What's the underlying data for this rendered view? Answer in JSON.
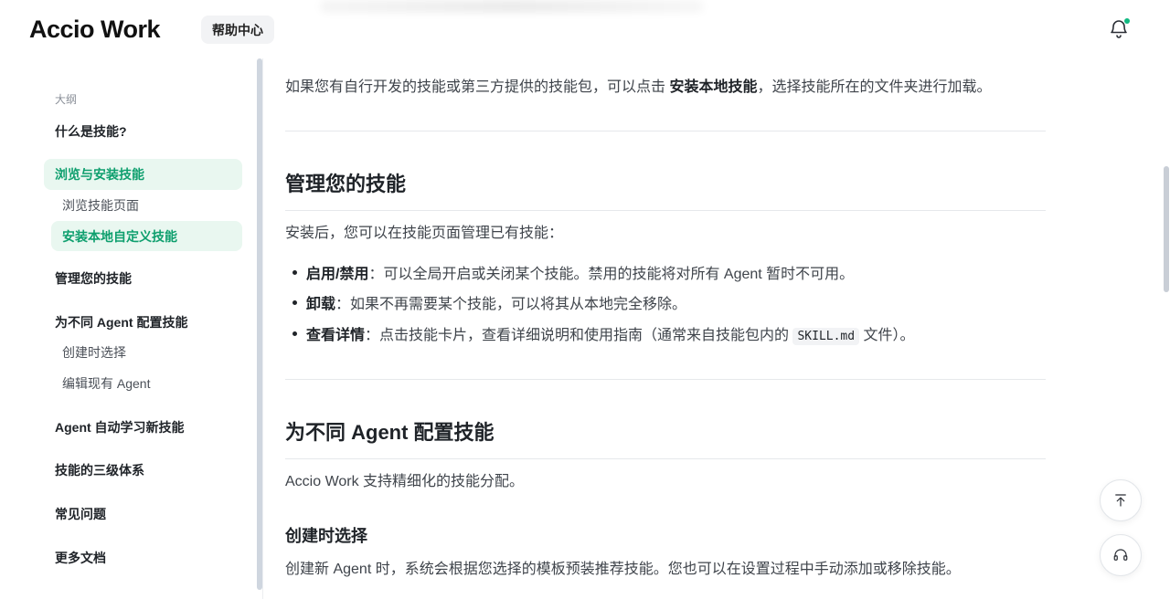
{
  "header": {
    "logo_text": "Accio Work",
    "help_badge": "帮助中心",
    "bell_icon": "bell-icon",
    "notification_dot_color": "#10b981"
  },
  "ghost": {
    "heading": "安装本地自定义技能"
  },
  "sidebar": {
    "outline_label": "大纲",
    "items": [
      {
        "label": "什么是技能?"
      },
      {
        "label": "浏览与安装技能"
      },
      {
        "label": "浏览技能页面"
      },
      {
        "label": "安装本地自定义技能"
      },
      {
        "label": "管理您的技能"
      },
      {
        "label": "为不同 Agent 配置技能"
      },
      {
        "label": "创建时选择"
      },
      {
        "label": "编辑现有 Agent"
      },
      {
        "label": "Agent 自动学习新技能"
      },
      {
        "label": "技能的三级体系"
      },
      {
        "label": "常见问题"
      },
      {
        "label": "更多文档"
      }
    ]
  },
  "content": {
    "local_install": {
      "prefix": "如果您有自行开发的技能或第三方提供的技能包，可以点击 ",
      "bold": "安装本地技能",
      "suffix": "，选择技能所在的文件夹进行加载。"
    },
    "manage": {
      "heading": "管理您的技能",
      "intro": "安装后，您可以在技能页面管理已有技能：",
      "items": [
        {
          "term": "启用/禁用",
          "text": "：可以全局开启或关闭某个技能。禁用的技能将对所有 Agent 暂时不可用。"
        },
        {
          "term": "卸载",
          "text": "：如果不再需要某个技能，可以将其从本地完全移除。"
        },
        {
          "term": "查看详情",
          "text": "：点击技能卡片，查看详细说明和使用指南（通常来自技能包内的 ",
          "code": "SKILL.md",
          "tail": " 文件）。"
        }
      ]
    },
    "configure": {
      "heading": "为不同 Agent 配置技能",
      "intro": "Accio Work 支持精细化的技能分配。",
      "sub_heading": "创建时选择",
      "sub_text": "创建新 Agent 时，系统会根据您选择的模板预装推荐技能。您也可以在设置过程中手动添加或移除技能。"
    }
  },
  "fabs": {
    "top_icon": "back-to-top-icon",
    "support_icon": "headset-icon"
  },
  "colors": {
    "accent": "#0e9f6e",
    "active_bg": "#e9f7f0"
  }
}
